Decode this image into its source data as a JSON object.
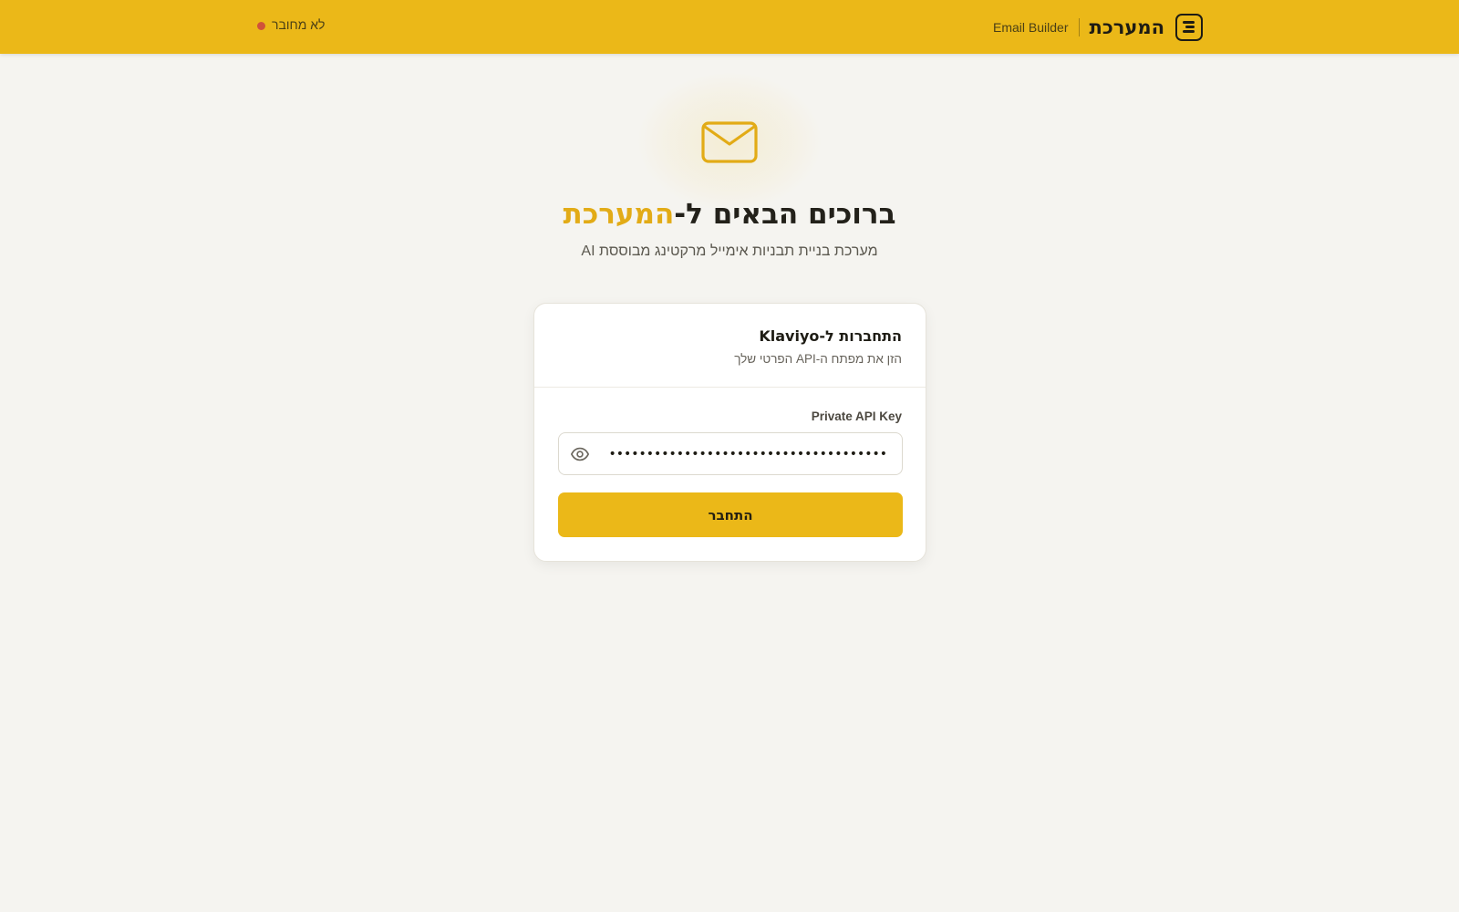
{
  "header": {
    "brand_name": "המערכת",
    "brand_subtitle": "Email Builder",
    "connection_status": "לא מחובר",
    "status_color": "#d0523a",
    "background_color": "#ebb818",
    "logo_icon": "document-icon"
  },
  "hero": {
    "icon": "envelope-icon",
    "title_prefix": "ברוכים הבאים ל-",
    "title_accent": "המערכת",
    "accent_color": "#e2ab16",
    "subtitle": "מערכת בניית תבניות אימייל מרקטינג מבוססת AI"
  },
  "login_card": {
    "title": "התחברות ל-Klaviyo",
    "description": "הזן את מפתח ה-API הפרטי שלך",
    "field_label": "Private API Key",
    "api_key_value": "•••••••••••••••••••••••••••••••••••••",
    "visibility_icon": "eye-icon",
    "submit_label": "התחבר",
    "button_color": "#ebb818"
  }
}
